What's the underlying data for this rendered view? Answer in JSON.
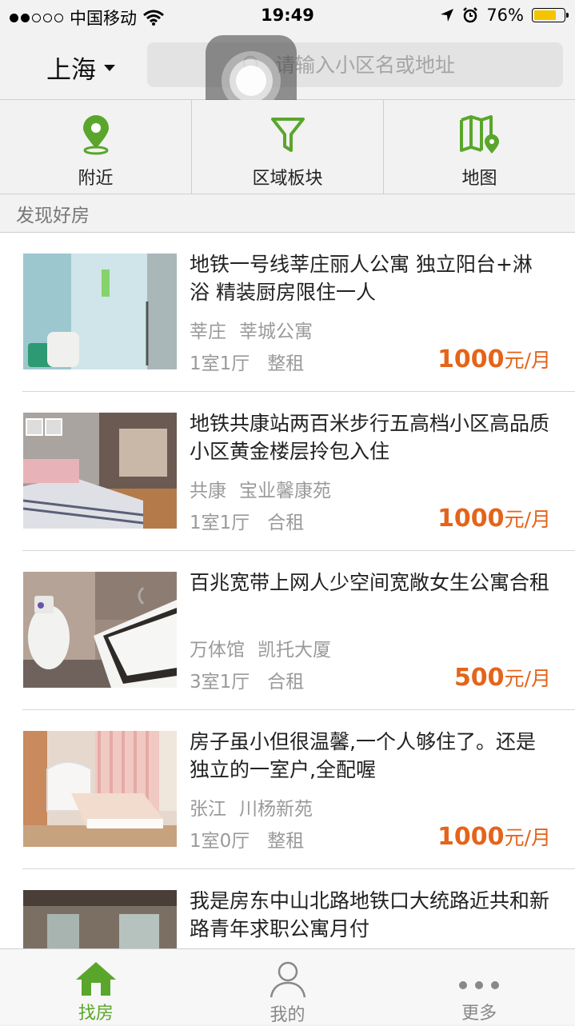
{
  "status_bar": {
    "carrier": "中国移动",
    "time": "19:49",
    "battery": "76%",
    "battery_level": 0.76
  },
  "header": {
    "city": "上海",
    "search_placeholder": "请输入小区名或地址"
  },
  "quick_nav": [
    {
      "label": "附近",
      "icon": "location-pin-icon"
    },
    {
      "label": "区域板块",
      "icon": "filter-icon"
    },
    {
      "label": "地图",
      "icon": "map-icon"
    }
  ],
  "section_title": "发现好房",
  "listings": [
    {
      "title": "地铁一号线莘庄丽人公寓 独立阳台+淋浴 精装厨房限住一人",
      "area": "莘庄",
      "community": "莘城公寓",
      "layout": "1室1厅",
      "rent_type": "整租",
      "price": "1000",
      "unit": "元/月"
    },
    {
      "title": "地铁共康站两百米步行五高档小区高品质小区黄金楼层拎包入住",
      "area": "共康",
      "community": "宝业馨康苑",
      "layout": "1室1厅",
      "rent_type": "合租",
      "price": "1000",
      "unit": "元/月"
    },
    {
      "title": "百兆宽带上网人少空间宽敞女生公寓合租",
      "area": "万体馆",
      "community": "凯托大厦",
      "layout": "3室1厅",
      "rent_type": "合租",
      "price": "500",
      "unit": "元/月"
    },
    {
      "title": "房子虽小但很温馨,一个人够住了。还是独立的一室户,全配喔",
      "area": "张江",
      "community": "川杨新苑",
      "layout": "1室0厅",
      "rent_type": "整租",
      "price": "1000",
      "unit": "元/月"
    },
    {
      "title": " 我是房东中山北路地铁口大统路近共和新路青年求职公寓月付",
      "area": "",
      "community": "",
      "layout": "",
      "rent_type": "",
      "price": "",
      "unit": ""
    }
  ],
  "tabs": [
    {
      "label": "找房",
      "icon": "house-icon",
      "active": true
    },
    {
      "label": "我的",
      "icon": "person-icon",
      "active": false
    },
    {
      "label": "更多",
      "icon": "more-dots-icon",
      "active": false
    }
  ],
  "colors": {
    "accent_green": "#5aa62c",
    "price_orange": "#e4641a"
  }
}
